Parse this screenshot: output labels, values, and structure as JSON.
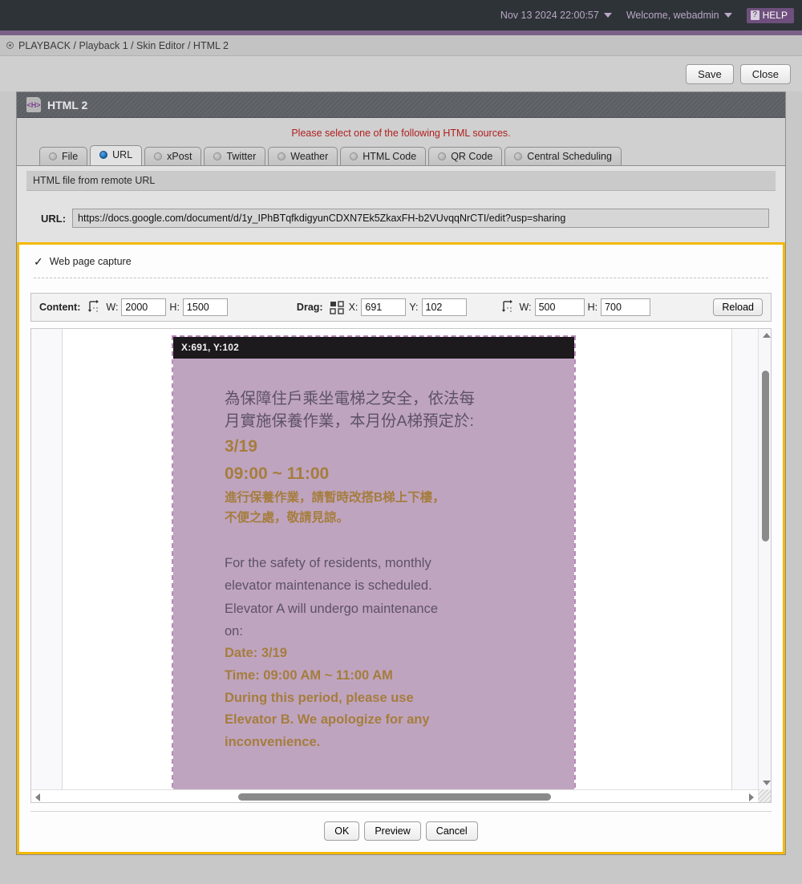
{
  "topbar": {
    "datetime": "Nov 13 2024 22:00:57",
    "welcome": "Welcome, webadmin",
    "help_label": "HELP",
    "help_icon_glyph": "?",
    "accent_color": "#7b6188"
  },
  "breadcrumb": {
    "text": "PLAYBACK / Playback 1 / Skin Editor / HTML 2"
  },
  "actions": {
    "save_label": "Save",
    "close_label": "Close"
  },
  "panel": {
    "title": "HTML 2",
    "icon_label": "<H>",
    "notice": "Please select one of the following HTML sources."
  },
  "tabs": [
    {
      "label": "File",
      "selected": false
    },
    {
      "label": "URL",
      "selected": true
    },
    {
      "label": "xPost",
      "selected": false
    },
    {
      "label": "Twitter",
      "selected": false
    },
    {
      "label": "Weather",
      "selected": false
    },
    {
      "label": "HTML Code",
      "selected": false
    },
    {
      "label": "QR Code",
      "selected": false
    },
    {
      "label": "Central Scheduling",
      "selected": false
    }
  ],
  "url_section": {
    "subheader": "HTML file from remote URL",
    "url_label": "URL:",
    "url_value": "https://docs.google.com/document/d/1y_IPhBTqfkdigyunCDXN7Ek5ZkaxFH-b2VUvqqNrCTI/edit?usp=sharing",
    "url_placeholder": "https://"
  },
  "capture": {
    "checkbox_label": "Web page capture",
    "checked": true,
    "highlight_color": "#f5b800",
    "toolbar": {
      "content_label": "Content:",
      "content_w_label": "W:",
      "content_w_value": "2000",
      "content_h_label": "H:",
      "content_h_value": "1500",
      "drag_label": "Drag:",
      "drag_x_label": "X:",
      "drag_x_value": "691",
      "drag_y_label": "Y:",
      "drag_y_value": "102",
      "crop_w_label": "W:",
      "crop_w_value": "500",
      "crop_h_label": "H:",
      "crop_h_value": "700",
      "reload_label": "Reload"
    },
    "preview": {
      "coord_overlay": "X:691, Y:102",
      "zh_gray_line1": "為保障住戶乘坐電梯之安全，依法每",
      "zh_gray_line2": "月實施保養作業，本月份A梯預定於:",
      "zh_date": "3/19",
      "zh_time": "09:00 ~ 11:00",
      "zh_gold_line1": "進行保養作業，請暫時改搭B梯上下樓，",
      "zh_gold_line2": "不便之處，敬請見諒。",
      "en_gray_line1": "For the safety of residents, monthly",
      "en_gray_line2": "elevator maintenance is scheduled.",
      "en_gray_line3": "Elevator A will undergo maintenance",
      "en_gray_line4": "on:",
      "en_date": "Date: 3/19",
      "en_time": "Time: 09:00 AM ~ 11:00 AM",
      "en_note_line1": "During this period, please use",
      "en_note_line2": "Elevator B. We apologize for any",
      "en_note_line3": "inconvenience.",
      "background_color": "#bfa4c0",
      "gold_color": "#a57d3d",
      "gray_color": "#5d5266"
    }
  },
  "dialog_footer": {
    "ok_label": "OK",
    "preview_label": "Preview",
    "cancel_label": "Cancel"
  }
}
